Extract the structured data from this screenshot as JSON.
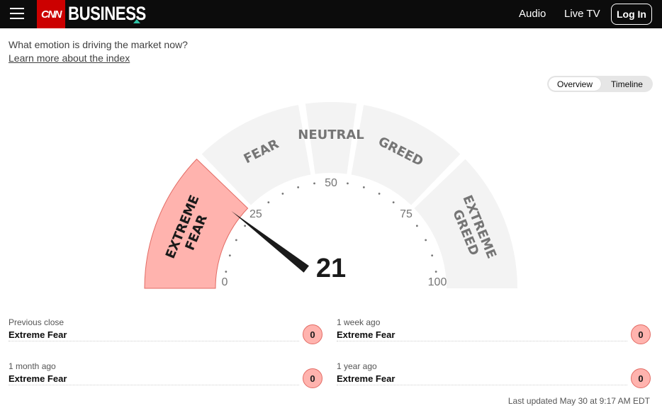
{
  "header": {
    "logo_text": "CNN",
    "section": "BUSINESS",
    "nav": {
      "audio": "Audio",
      "live_tv": "Live TV",
      "login": "Log In"
    },
    "brand_color": "#cc0000"
  },
  "intro": {
    "question": "What emotion is driving the market now?",
    "learn_more": "Learn more about the index"
  },
  "view_toggle": {
    "overview": "Overview",
    "timeline": "Timeline",
    "selected": "Overview"
  },
  "gauge": {
    "value": 21,
    "value_label": "21",
    "min_label": "0",
    "max_label": "100",
    "ticks": [
      "0",
      "25",
      "50",
      "75",
      "100"
    ],
    "bands": [
      {
        "name": "extreme-fear",
        "lines": [
          "EXTREME",
          "FEAR"
        ],
        "from": 0,
        "to": 25,
        "active": true
      },
      {
        "name": "fear",
        "lines": [
          "FEAR"
        ],
        "from": 25,
        "to": 45,
        "active": false
      },
      {
        "name": "neutral",
        "lines": [
          "NEUTRAL"
        ],
        "from": 45,
        "to": 55,
        "active": false
      },
      {
        "name": "greed",
        "lines": [
          "GREED"
        ],
        "from": 55,
        "to": 75,
        "active": false
      },
      {
        "name": "extreme-greed",
        "lines": [
          "EXTREME",
          "GREED"
        ],
        "from": 75,
        "to": 100,
        "active": false
      }
    ],
    "colors": {
      "band": "#f3f3f3",
      "active": "#ffb3ae",
      "active_border": "#e36b64",
      "text": "#757575",
      "active_text": "#1a1a1a"
    }
  },
  "stats": [
    {
      "label": "Previous close",
      "value": "Extreme Fear",
      "score": "0"
    },
    {
      "label": "1 week ago",
      "value": "Extreme Fear",
      "score": "0"
    },
    {
      "label": "1 month ago",
      "value": "Extreme Fear",
      "score": "0"
    },
    {
      "label": "1 year ago",
      "value": "Extreme Fear",
      "score": "0"
    }
  ],
  "last_updated": "Last updated May 30 at 9:17 AM EDT"
}
